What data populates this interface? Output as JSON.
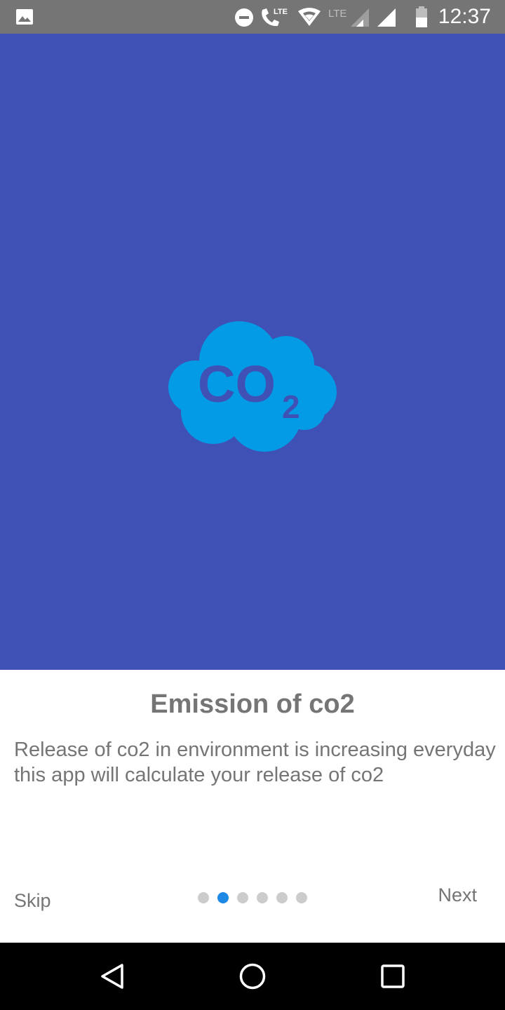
{
  "status_bar": {
    "time": "12:37",
    "network_label": "LTE",
    "call_label": "LTE",
    "icons": [
      "image-icon",
      "do-not-disturb-icon",
      "volte-call-icon",
      "wifi-icon",
      "signal-icon",
      "signal-icon",
      "battery-icon"
    ],
    "background_color": "#757575"
  },
  "hero": {
    "background_color": "#3F51B5",
    "illustration": {
      "icon": "co2-cloud-icon",
      "cloud_color": "#039BE5",
      "text_main": "CO",
      "text_sub": "2"
    }
  },
  "onboarding": {
    "title": "Emission of co2",
    "description_lines": [
      "Release of co2 in environment is increasing everyday",
      "this app will calculate your release of co2"
    ],
    "skip_label": "Skip",
    "next_label": "Next",
    "page_count": 6,
    "current_page": 2,
    "active_dot_color": "#1E88E5",
    "inactive_dot_color": "#CCCCCC"
  },
  "nav_bar": {
    "icons": [
      "back-icon",
      "home-icon",
      "recents-icon"
    ]
  }
}
